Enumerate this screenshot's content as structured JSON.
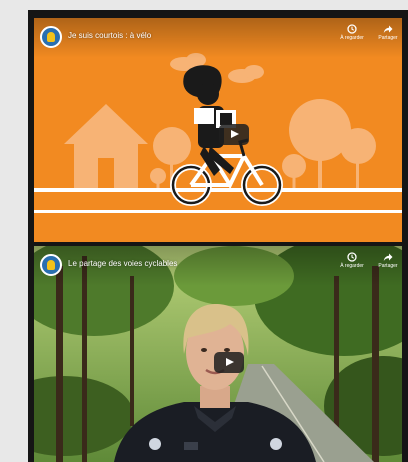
{
  "videos": [
    {
      "title": "Je suis courtois : à vélo",
      "watch_later_label": "À regarder",
      "share_label": "Partager"
    },
    {
      "title": "Le partage des voies cyclables",
      "watch_later_label": "À regarder",
      "share_label": "Partager"
    }
  ],
  "colors": {
    "scene1_background": "#f28a21",
    "scene1_shapes": "#f7b375",
    "scene1_road_lines": "#ffffff"
  },
  "icons": [
    "channel-avatar",
    "clock-icon",
    "share-arrow-icon",
    "play-icon",
    "bicycle",
    "cyclist",
    "house",
    "trees"
  ]
}
